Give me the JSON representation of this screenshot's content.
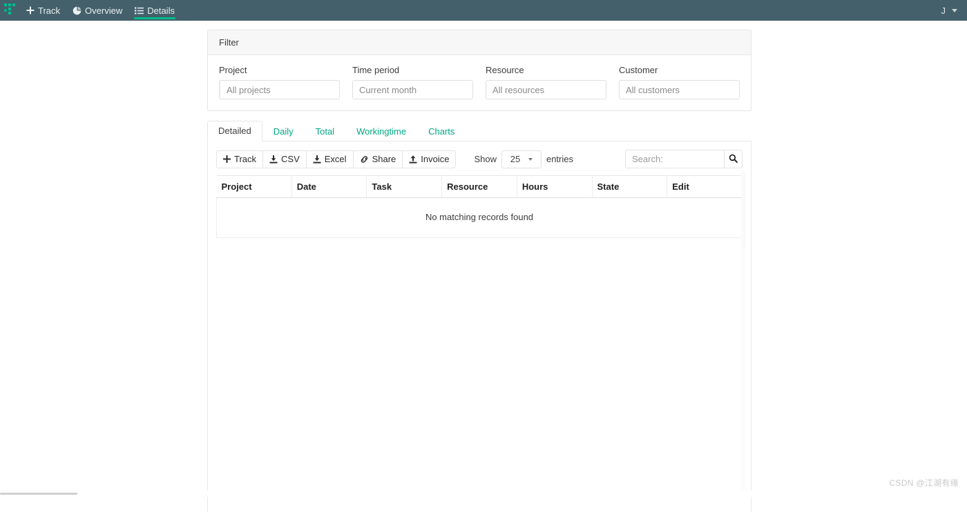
{
  "navbar": {
    "brand_icon": "kimai-logo-icon",
    "items": [
      {
        "label": "Track",
        "icon": "plus-icon",
        "active": false
      },
      {
        "label": "Overview",
        "icon": "pie-chart-icon",
        "active": false
      },
      {
        "label": "Details",
        "icon": "list-icon",
        "active": true
      }
    ],
    "user_initial": "J",
    "user_caret_icon": "caret-down-icon",
    "background_color": "#44606b",
    "accent_color": "#00bc8c"
  },
  "filter": {
    "title": "Filter",
    "fields": [
      {
        "label": "Project",
        "value": "All projects",
        "name": "project"
      },
      {
        "label": "Time period",
        "value": "Current month",
        "name": "time-period"
      },
      {
        "label": "Resource",
        "value": "All resources",
        "name": "resource"
      },
      {
        "label": "Customer",
        "value": "All customers",
        "name": "customer"
      }
    ]
  },
  "tabs": [
    {
      "label": "Detailed",
      "active": true
    },
    {
      "label": "Daily",
      "active": false
    },
    {
      "label": "Total",
      "active": false
    },
    {
      "label": "Workingtime",
      "active": false
    },
    {
      "label": "Charts",
      "active": false
    }
  ],
  "toolbar": {
    "buttons": [
      {
        "label": "Track",
        "icon": "plus-icon"
      },
      {
        "label": "CSV",
        "icon": "download-icon"
      },
      {
        "label": "Excel",
        "icon": "download-icon"
      },
      {
        "label": "Share",
        "icon": "link-icon"
      },
      {
        "label": "Invoice",
        "icon": "upload-icon"
      }
    ],
    "show_label": "Show",
    "entries_value": "25",
    "entries_label": "entries",
    "search_placeholder": "Search:",
    "search_value": "",
    "search_icon": "search-icon"
  },
  "table": {
    "columns": [
      "Project",
      "Date",
      "Task",
      "Resource",
      "Hours",
      "State",
      "Edit"
    ],
    "rows": [],
    "empty_message": "No matching records found"
  },
  "watermark": "CSDN @江湖有缘"
}
